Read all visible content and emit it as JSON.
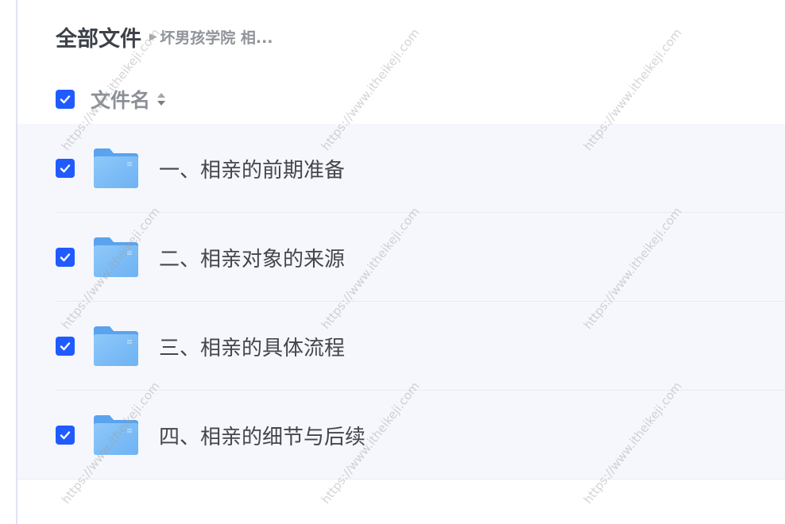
{
  "breadcrumb": {
    "root": "全部文件",
    "current": "坏男孩学院 相..."
  },
  "header": {
    "column_label": "文件名",
    "select_all_checked": true
  },
  "files": [
    {
      "name": "一、相亲的前期准备",
      "type": "folder",
      "checked": true
    },
    {
      "name": "二、相亲对象的来源",
      "type": "folder",
      "checked": true
    },
    {
      "name": "三、相亲的具体流程",
      "type": "folder",
      "checked": true
    },
    {
      "name": "四、相亲的细节与后续",
      "type": "folder",
      "checked": true
    }
  ],
  "watermark": "https://www.itheikeji.com",
  "colors": {
    "accent": "#1f5bff",
    "folder": "#6fb5f5",
    "row_bg": "#f6f7fc"
  }
}
